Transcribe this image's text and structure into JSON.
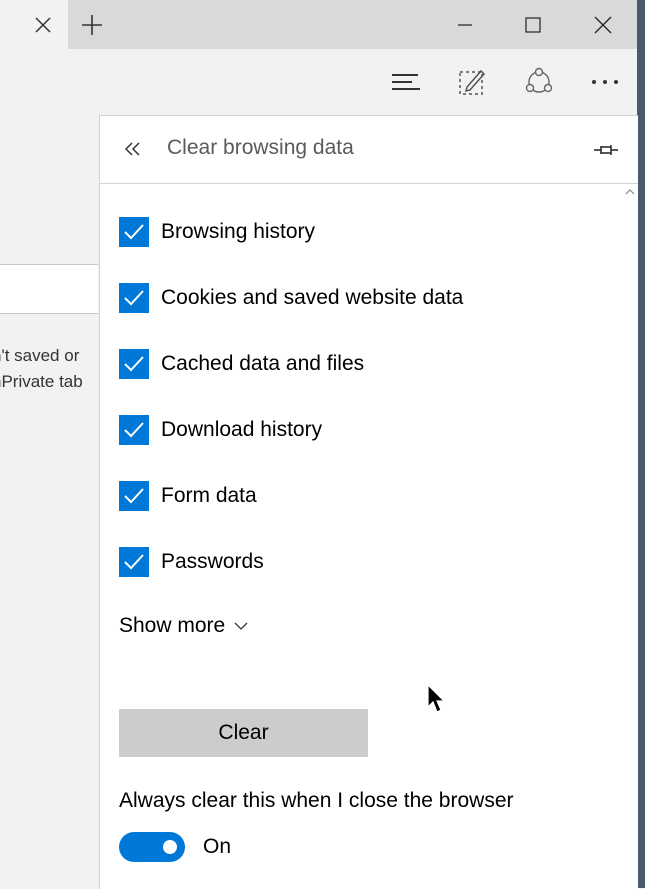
{
  "window": {
    "new_tab_symbol": "+"
  },
  "page": {
    "text_line_1": "n't saved or",
    "text_line_2": "nPrivate tab"
  },
  "panel": {
    "title": "Clear browsing data",
    "options": [
      {
        "label": "Browsing history",
        "checked": true
      },
      {
        "label": "Cookies and saved website data",
        "checked": true
      },
      {
        "label": "Cached data and files",
        "checked": true
      },
      {
        "label": "Download history",
        "checked": true
      },
      {
        "label": "Form data",
        "checked": true
      },
      {
        "label": "Passwords",
        "checked": true
      }
    ],
    "show_more_label": "Show more",
    "clear_button_label": "Clear",
    "always_clear_label": "Always clear this when I close the browser",
    "toggle_state_label": "On",
    "toggle_on": true
  },
  "colors": {
    "accent": "#0078d7",
    "panel_bg": "#ffffff",
    "chrome_bg": "#f2f2f2",
    "titlebar_bg": "#d9d9d9",
    "button_gray": "#cccccc"
  },
  "icons": {
    "tab_close": "close-icon",
    "new_tab": "plus-icon",
    "minimize": "minimize-icon",
    "maximize": "maximize-icon",
    "window_close": "close-icon",
    "hub": "hub-icon",
    "web_note": "web-note-icon",
    "share": "share-icon",
    "more": "more-icon",
    "back": "double-chevron-left-icon",
    "pin": "pin-icon",
    "show_more": "chevron-down-icon"
  }
}
